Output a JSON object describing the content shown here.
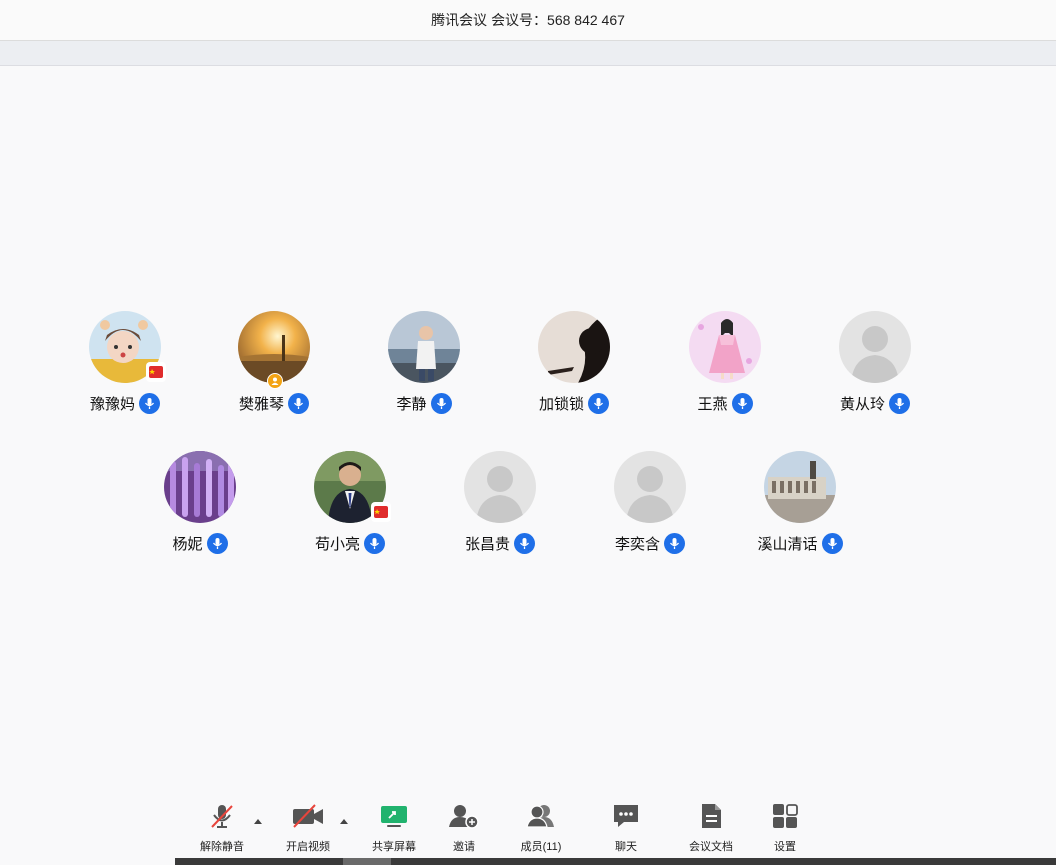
{
  "window": {
    "app_name": "腾讯会议",
    "meeting_label": "会议号：568 842 467"
  },
  "participants": [
    {
      "name": "豫豫妈",
      "avatar": "photo-child",
      "badge": "flag"
    },
    {
      "name": "樊雅琴",
      "avatar": "photo-sunset",
      "badge": "host"
    },
    {
      "name": "李静",
      "avatar": "photo-boy-sea",
      "badge": ""
    },
    {
      "name": "加锁锁",
      "avatar": "photo-silhouette",
      "badge": ""
    },
    {
      "name": "王燕",
      "avatar": "illustration-girl-pink",
      "badge": ""
    },
    {
      "name": "黄从玲",
      "avatar": "default-user",
      "badge": ""
    },
    {
      "name": "杨妮",
      "avatar": "photo-wisteria",
      "badge": ""
    },
    {
      "name": "苟小亮",
      "avatar": "photo-man-suit",
      "badge": "flag"
    },
    {
      "name": "张昌贵",
      "avatar": "default-user",
      "badge": ""
    },
    {
      "name": "李奕含",
      "avatar": "default-user",
      "badge": ""
    },
    {
      "name": "溪山清话",
      "avatar": "photo-building",
      "badge": ""
    }
  ],
  "toolbar": {
    "unmute": "解除静音",
    "start_video": "开启视频",
    "share_screen": "共享屏幕",
    "invite": "邀请",
    "members": "成员(11)",
    "chat": "聊天",
    "docs": "会议文档",
    "settings": "设置"
  },
  "colors": {
    "mic_blue": "#1f6fe8",
    "share_green": "#21b36e",
    "muted_red": "#e8453c",
    "host_orange": "#f3a313"
  }
}
